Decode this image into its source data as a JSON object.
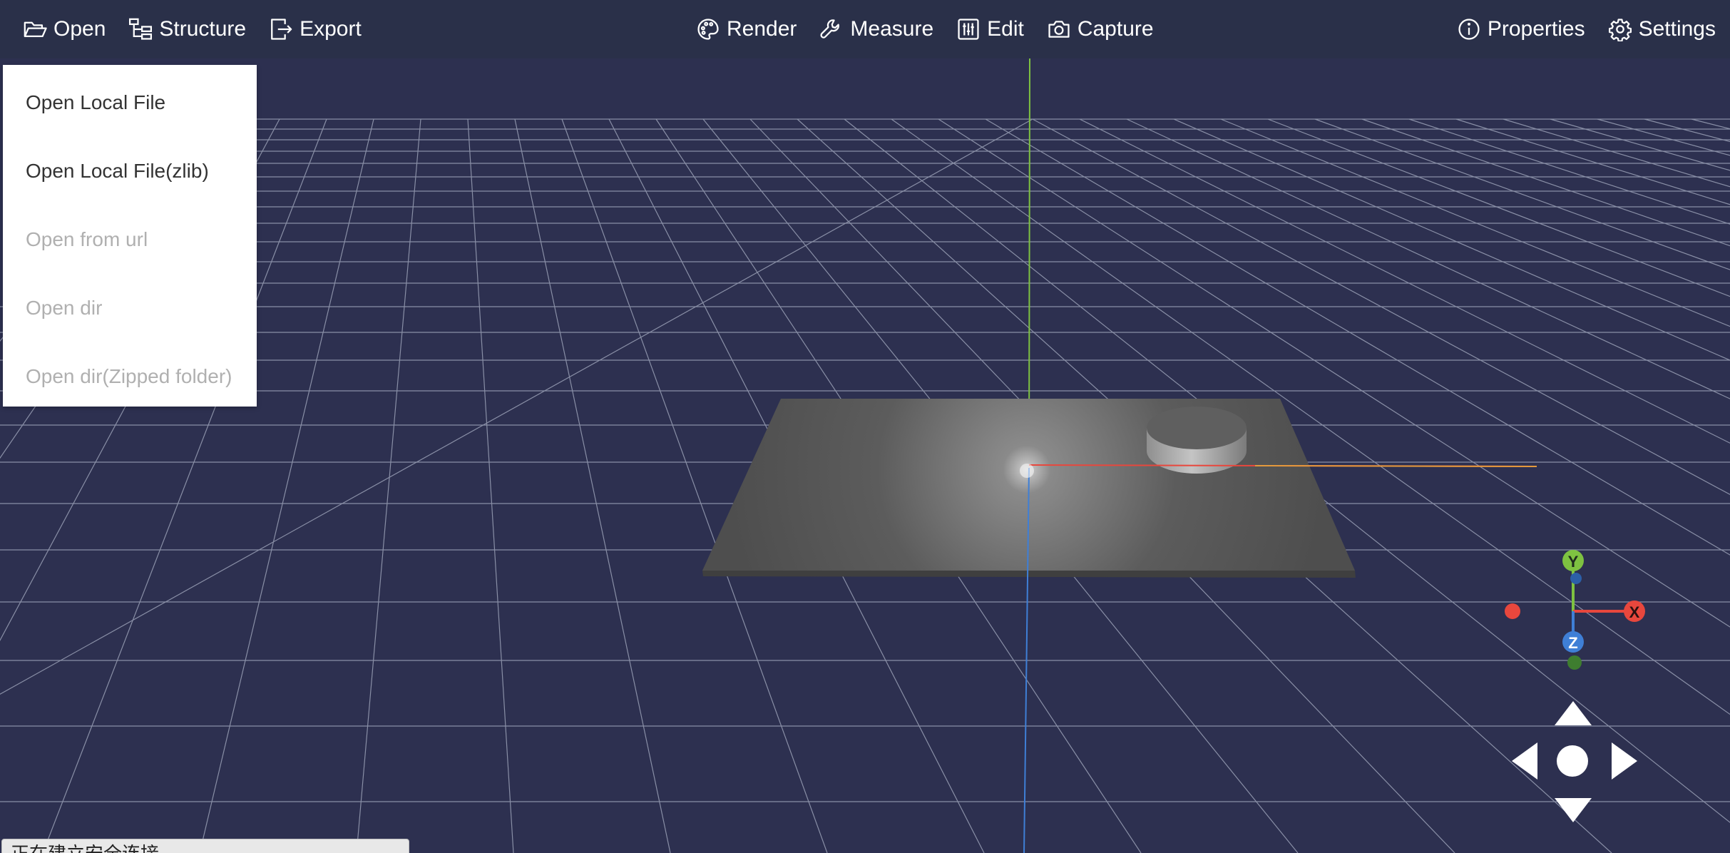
{
  "toolbar": {
    "left": [
      {
        "label": "Open",
        "icon": "folder-open-icon"
      },
      {
        "label": "Structure",
        "icon": "structure-tree-icon"
      },
      {
        "label": "Export",
        "icon": "export-icon"
      }
    ],
    "center": [
      {
        "label": "Render",
        "icon": "palette-icon"
      },
      {
        "label": "Measure",
        "icon": "wrench-icon"
      },
      {
        "label": "Edit",
        "icon": "sliders-icon"
      },
      {
        "label": "Capture",
        "icon": "camera-icon"
      }
    ],
    "right": [
      {
        "label": "Properties",
        "icon": "info-icon"
      },
      {
        "label": "Settings",
        "icon": "gear-icon"
      }
    ]
  },
  "open_menu": {
    "items": [
      {
        "label": "Open Local File",
        "enabled": true
      },
      {
        "label": "Open Local File(zlib)",
        "enabled": true
      },
      {
        "label": "Open from url",
        "enabled": false
      },
      {
        "label": "Open dir",
        "enabled": false
      },
      {
        "label": "Open dir(Zipped folder)",
        "enabled": false
      }
    ]
  },
  "gizmo": {
    "y_label": "Y",
    "x_label": "X",
    "z_label": "Z"
  },
  "status": {
    "text": "正在建立安全连接..."
  },
  "colors": {
    "toolbar_bg": "#2a3049",
    "scene_bg": "#2d3050",
    "grid_line": "#9aa0b6",
    "axis_x": "#e8473d",
    "axis_y": "#7ec241",
    "axis_z": "#3f7fd6",
    "plate": "#595959"
  }
}
